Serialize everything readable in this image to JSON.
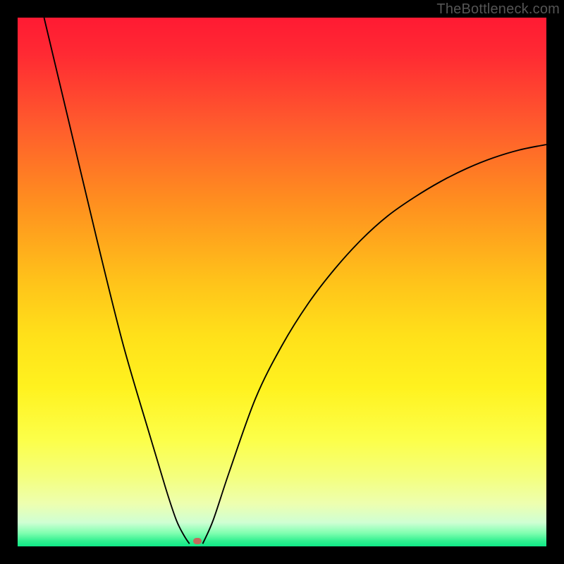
{
  "watermark": "TheBottleneck.com",
  "chart_data": {
    "type": "line",
    "title": "",
    "xlabel": "",
    "ylabel": "",
    "xlim": [
      0,
      100
    ],
    "ylim": [
      0,
      100
    ],
    "background_gradient_stops": [
      {
        "pos": 0.0,
        "color": "#ff1a33"
      },
      {
        "pos": 0.07,
        "color": "#ff2a33"
      },
      {
        "pos": 0.2,
        "color": "#ff5a2d"
      },
      {
        "pos": 0.35,
        "color": "#ff8f1f"
      },
      {
        "pos": 0.5,
        "color": "#ffc31a"
      },
      {
        "pos": 0.6,
        "color": "#ffe01a"
      },
      {
        "pos": 0.7,
        "color": "#fff21f"
      },
      {
        "pos": 0.8,
        "color": "#fcff4a"
      },
      {
        "pos": 0.87,
        "color": "#f4ff7f"
      },
      {
        "pos": 0.92,
        "color": "#edffb0"
      },
      {
        "pos": 0.955,
        "color": "#cfffd3"
      },
      {
        "pos": 0.975,
        "color": "#80ffb0"
      },
      {
        "pos": 0.99,
        "color": "#30f090"
      },
      {
        "pos": 1.0,
        "color": "#10e887"
      }
    ],
    "curve_left": [
      {
        "x": 5.0,
        "y": 100.0
      },
      {
        "x": 10.0,
        "y": 79.0
      },
      {
        "x": 15.0,
        "y": 58.0
      },
      {
        "x": 20.0,
        "y": 38.0
      },
      {
        "x": 25.0,
        "y": 21.0
      },
      {
        "x": 28.0,
        "y": 11.0
      },
      {
        "x": 30.0,
        "y": 5.0
      },
      {
        "x": 31.5,
        "y": 2.0
      },
      {
        "x": 32.5,
        "y": 0.5
      }
    ],
    "curve_right": [
      {
        "x": 35.0,
        "y": 0.5
      },
      {
        "x": 37.0,
        "y": 5.0
      },
      {
        "x": 40.0,
        "y": 14.0
      },
      {
        "x": 45.0,
        "y": 28.0
      },
      {
        "x": 50.0,
        "y": 38.0
      },
      {
        "x": 55.0,
        "y": 46.0
      },
      {
        "x": 60.0,
        "y": 52.5
      },
      {
        "x": 65.0,
        "y": 58.0
      },
      {
        "x": 70.0,
        "y": 62.5
      },
      {
        "x": 75.0,
        "y": 66.0
      },
      {
        "x": 80.0,
        "y": 69.0
      },
      {
        "x": 85.0,
        "y": 71.5
      },
      {
        "x": 90.0,
        "y": 73.5
      },
      {
        "x": 95.0,
        "y": 75.0
      },
      {
        "x": 100.0,
        "y": 76.0
      }
    ],
    "marker": {
      "x": 34.0,
      "y": 1.0,
      "color": "#c4695c"
    }
  }
}
